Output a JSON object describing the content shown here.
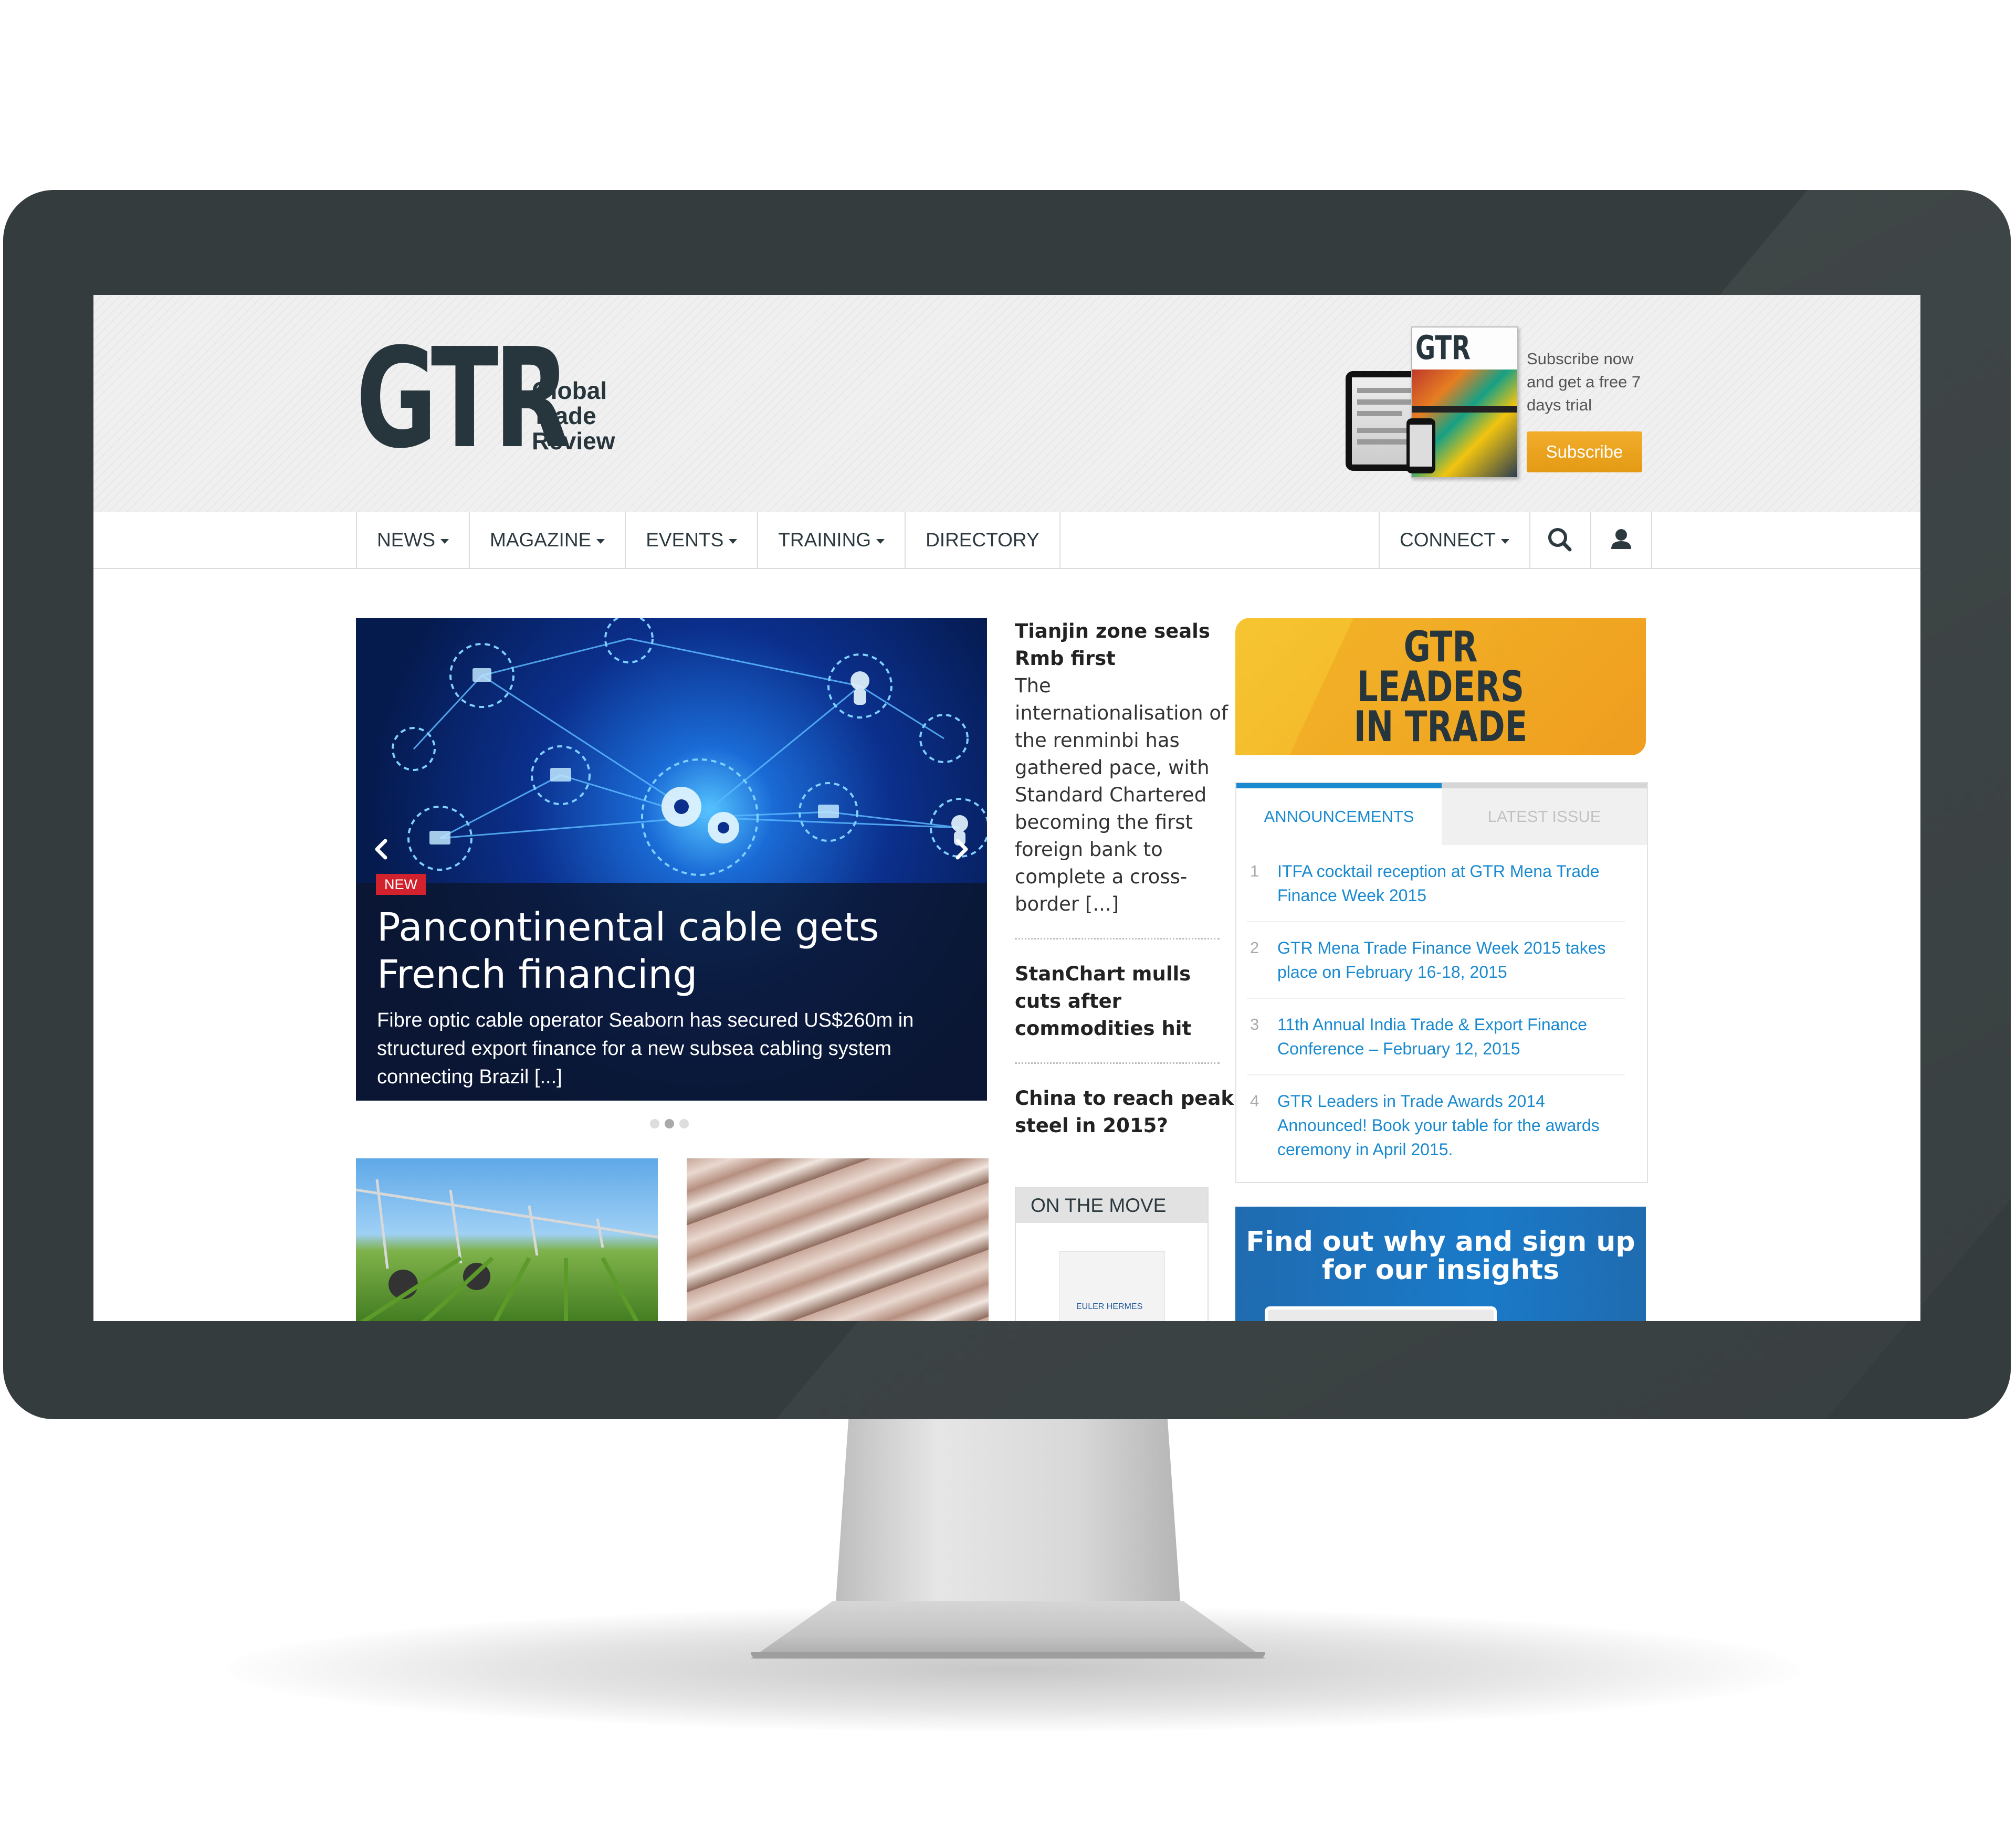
{
  "header": {
    "logo_mark": "GTR",
    "logo_line1": "Global",
    "logo_line2": "Trade",
    "logo_line3": "Review",
    "promo_text": "Subscribe now and get a free 7 days trial",
    "promo_magazine": "GTR",
    "subscribe_label": "Subscribe"
  },
  "nav": {
    "items": [
      {
        "label": "NEWS",
        "dropdown": true
      },
      {
        "label": "MAGAZINE",
        "dropdown": true
      },
      {
        "label": "EVENTS",
        "dropdown": true
      },
      {
        "label": "TRAINING",
        "dropdown": true
      },
      {
        "label": "DIRECTORY",
        "dropdown": false
      }
    ],
    "connect_label": "CONNECT",
    "icons": [
      "search-icon",
      "user-icon"
    ]
  },
  "carousel": {
    "badge": "NEW",
    "title": "Pancontinental cable gets French financing",
    "summary": "Fibre optic cable operator Seaborn has secured US$260m in structured export finance for a new subsea cabling system connecting Brazil [...]",
    "slides": 3,
    "active_slide": 2
  },
  "stories": [
    {
      "title": "Tianjin zone seals Rmb first",
      "body": "The internationalisation of the renminbi has gathered pace, with Standard Chartered becoming the first foreign bank to complete a cross-border [...]"
    },
    {
      "title": "StanChart mulls cuts after commodities hit",
      "body": ""
    },
    {
      "title": "China to reach peak steel in 2015?",
      "body": ""
    }
  ],
  "on_the_move": {
    "heading": "ON THE MOVE",
    "logo_text": "EULER HERMES"
  },
  "leaders_banner": {
    "line1": "GTR",
    "line2": "LEADERS",
    "line3": "IN TRADE"
  },
  "tabs": {
    "active": "ANNOUNCEMENTS",
    "inactive": "LATEST ISSUE",
    "announcements": [
      "ITFA cocktail reception at GTR Mena Trade Finance Week 2015",
      "GTR Mena Trade Finance Week 2015 takes place on February 16-18, 2015",
      "11th Annual India Trade & Export Finance Conference – February 12, 2015",
      "GTR Leaders in Trade Awards 2014 Announced! Book your table for the awards ceremony in April 2015."
    ]
  },
  "insights_banner": {
    "line1": "Find out why and sign up",
    "line2": "for our insights"
  },
  "colors": {
    "accent_blue": "#1a8ad0",
    "subscribe_orange": "#e9a21c",
    "new_badge_red": "#d2222d",
    "logo_dark": "#27353c",
    "bezel": "#353c3d"
  }
}
